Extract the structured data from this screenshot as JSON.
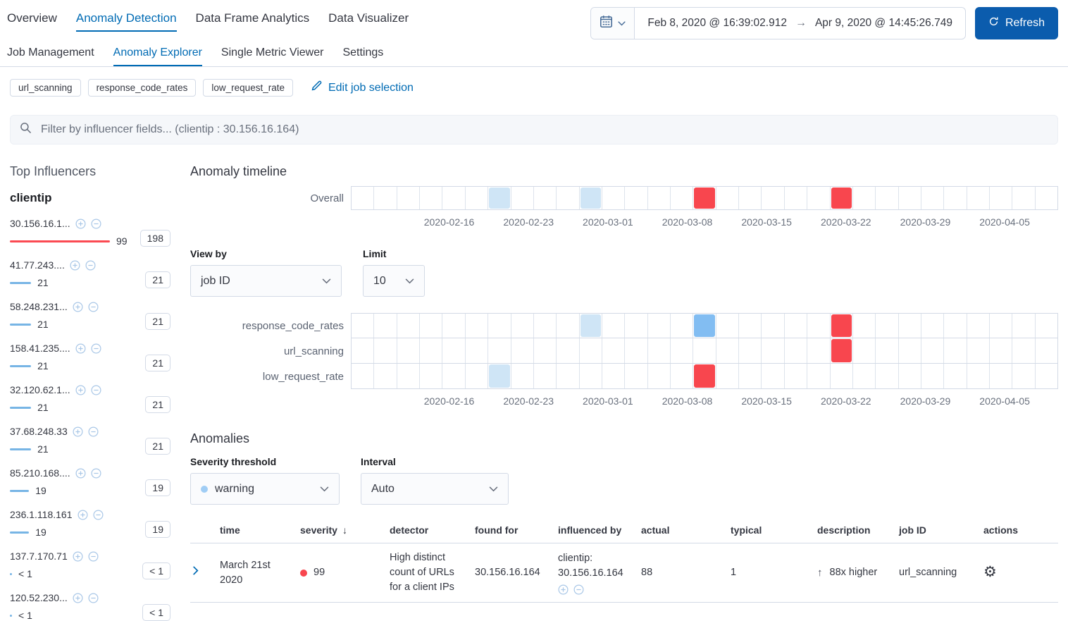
{
  "nav": {
    "tabs": [
      {
        "label": "Overview",
        "active": false
      },
      {
        "label": "Anomaly Detection",
        "active": true
      },
      {
        "label": "Data Frame Analytics",
        "active": false
      },
      {
        "label": "Data Visualizer",
        "active": false
      }
    ],
    "subtabs": [
      {
        "label": "Job Management",
        "active": false
      },
      {
        "label": "Anomaly Explorer",
        "active": true
      },
      {
        "label": "Single Metric Viewer",
        "active": false
      },
      {
        "label": "Settings",
        "active": false
      }
    ]
  },
  "datepicker": {
    "start": "Feb 8, 2020 @ 16:39:02.912",
    "end": "Apr 9, 2020 @ 14:45:26.749",
    "refresh_label": "Refresh"
  },
  "jobs": {
    "badges": [
      "url_scanning",
      "response_code_rates",
      "low_request_rate"
    ],
    "edit_label": "Edit job selection"
  },
  "filter": {
    "placeholder": "Filter by influencer fields... (clientip : 30.156.16.164)"
  },
  "influencers": {
    "title": "Top Influencers",
    "field": "clientip",
    "items": [
      {
        "label": "30.156.16.1...",
        "score": "99",
        "value": 99,
        "badge": "198",
        "color": "red"
      },
      {
        "label": "41.77.243....",
        "score": "21",
        "value": 21,
        "badge": "21",
        "color": "blue"
      },
      {
        "label": "58.248.231...",
        "score": "21",
        "value": 21,
        "badge": "21",
        "color": "blue"
      },
      {
        "label": "158.41.235....",
        "score": "21",
        "value": 21,
        "badge": "21",
        "color": "blue"
      },
      {
        "label": "32.120.62.1...",
        "score": "21",
        "value": 21,
        "badge": "21",
        "color": "blue"
      },
      {
        "label": "37.68.248.33",
        "score": "21",
        "value": 21,
        "badge": "21",
        "color": "blue"
      },
      {
        "label": "85.210.168....",
        "score": "19",
        "value": 19,
        "badge": "19",
        "color": "blue"
      },
      {
        "label": "236.1.118.161",
        "score": "19",
        "value": 19,
        "badge": "19",
        "color": "blue"
      },
      {
        "label": "137.7.170.71",
        "score": "< 1",
        "value": 0.5,
        "badge": "< 1",
        "color": "blue"
      },
      {
        "label": "120.52.230...",
        "score": "< 1",
        "value": 0.5,
        "badge": "< 1",
        "color": "blue"
      }
    ]
  },
  "timeline": {
    "title": "Anomaly timeline",
    "overall_label": "Overall",
    "cells_per_lane": 31,
    "ticks": [
      "2020-02-16",
      "2020-02-23",
      "2020-03-01",
      "2020-03-08",
      "2020-03-15",
      "2020-03-22",
      "2020-03-29",
      "2020-04-05"
    ],
    "overall_cells": [
      {
        "index": 6,
        "severity": "low"
      },
      {
        "index": 10,
        "severity": "low"
      },
      {
        "index": 15,
        "severity": "critical"
      },
      {
        "index": 21,
        "severity": "critical"
      }
    ],
    "view_by": {
      "label": "View by",
      "value": "job ID"
    },
    "limit": {
      "label": "Limit",
      "value": "10"
    },
    "lanes": [
      {
        "label": "response_code_rates",
        "cells": [
          {
            "index": 10,
            "severity": "low"
          },
          {
            "index": 15,
            "severity": "warning"
          },
          {
            "index": 21,
            "severity": "critical"
          }
        ]
      },
      {
        "label": "url_scanning",
        "cells": [
          {
            "index": 21,
            "severity": "critical"
          }
        ]
      },
      {
        "label": "low_request_rate",
        "cells": [
          {
            "index": 6,
            "severity": "low"
          },
          {
            "index": 15,
            "severity": "critical"
          }
        ]
      }
    ]
  },
  "anomalies": {
    "title": "Anomalies",
    "severity_threshold": {
      "label": "Severity threshold",
      "value": "warning"
    },
    "interval": {
      "label": "Interval",
      "value": "Auto"
    },
    "table": {
      "columns": [
        "time",
        "severity",
        "detector",
        "found for",
        "influenced by",
        "actual",
        "typical",
        "description",
        "job ID",
        "actions"
      ],
      "rows": [
        {
          "time": "March 21st 2020",
          "severity": "99",
          "detector": "High distinct count of URLs for a client IPs",
          "found_for": "30.156.16.164",
          "influenced_by": "clientip: 30.156.16.164",
          "actual": "88",
          "typical": "1",
          "description": "88x higher",
          "job_id": "url_scanning"
        }
      ]
    }
  },
  "icons": {
    "sort_desc": "↓",
    "arrow_up": "↑",
    "arrow_right": "→",
    "gear": "⚙"
  },
  "colors": {
    "link": "#006bb4",
    "button": "#0b5cad",
    "severity_critical": "#f8464e",
    "severity_warning": "#82bdf2",
    "severity_low": "#cfe5f6",
    "bar_red": "#fb4a52",
    "bar_blue": "#77b5e5"
  }
}
